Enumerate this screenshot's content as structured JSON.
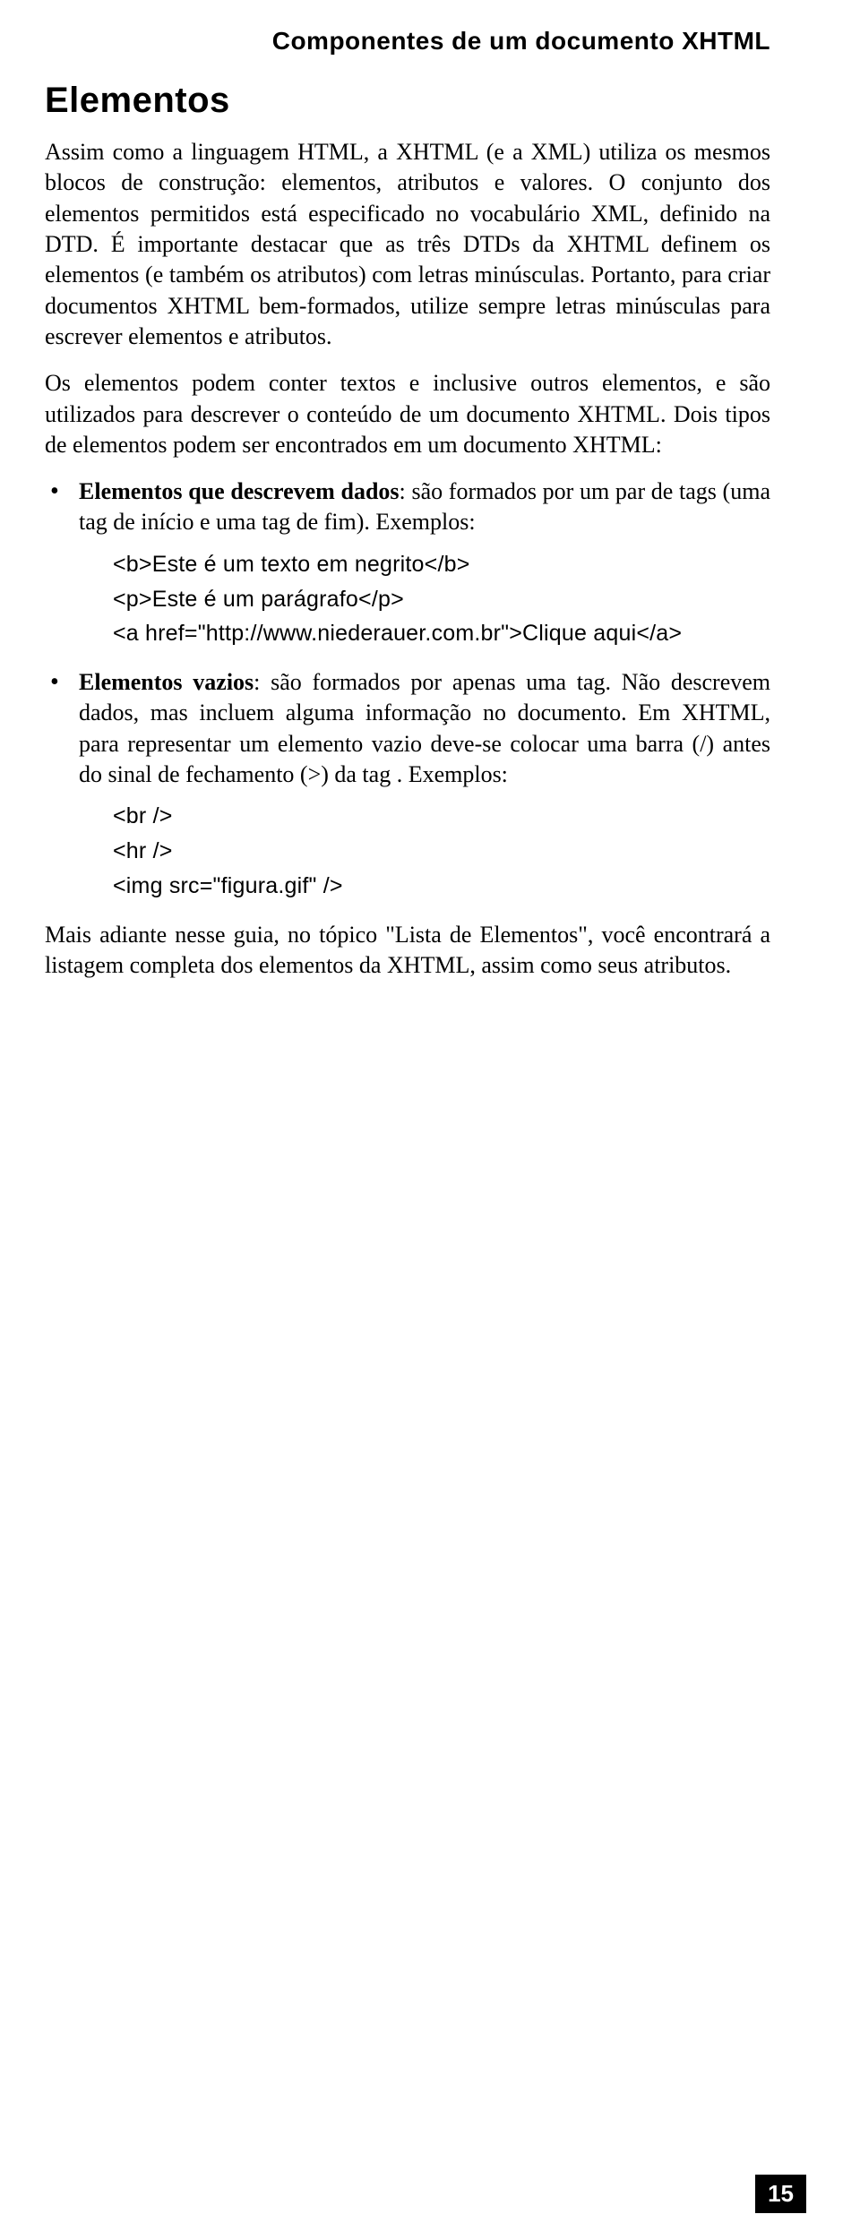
{
  "running_head": "Componentes de um documento XHTML",
  "section_title": "Elementos",
  "para1": "Assim como a linguagem HTML, a XHTML (e a XML) utiliza os mesmos blocos de construção: elementos, atributos e valores. O conjunto dos elementos permitidos está especificado no vocabulário XML, definido na DTD. É importante destacar que as três DTDs da XHTML definem os elementos (e também os atributos) com letras minúsculas. Portanto, para criar documentos XHTML bem-formados, utilize sempre letras minúsculas para escrever elementos e atributos.",
  "para2": "Os elementos podem conter textos e inclusive outros elementos, e são utilizados para descrever o conteúdo de um documento XHTML. Dois tipos de elementos podem ser encontrados em um documento XHTML:",
  "bullets": [
    {
      "lead": "Elementos que descrevem dados",
      "rest": ": são formados por um par de tags (uma tag de início e uma tag de fim). Exemplos:",
      "code": [
        "<b>Este é um texto em negrito</b>",
        "<p>Este é um parágrafo</p>",
        "<a href=\"http://www.niederauer.com.br\">Clique aqui</a>"
      ]
    },
    {
      "lead": "Elementos vazios",
      "rest": ": são formados por apenas uma tag. Não descrevem dados, mas incluem alguma informação no documento. Em XHTML, para representar um elemento vazio deve-se colocar uma barra (/) antes do sinal de fechamento (>) da tag . Exemplos:",
      "code": [
        "<br />",
        "<hr />",
        "<img src=\"figura.gif\" />"
      ]
    }
  ],
  "closing": "Mais adiante nesse guia, no tópico \"Lista de Elementos\", você encontrará a listagem completa dos elementos da XHTML, assim como seus atributos.",
  "page_number": "15"
}
